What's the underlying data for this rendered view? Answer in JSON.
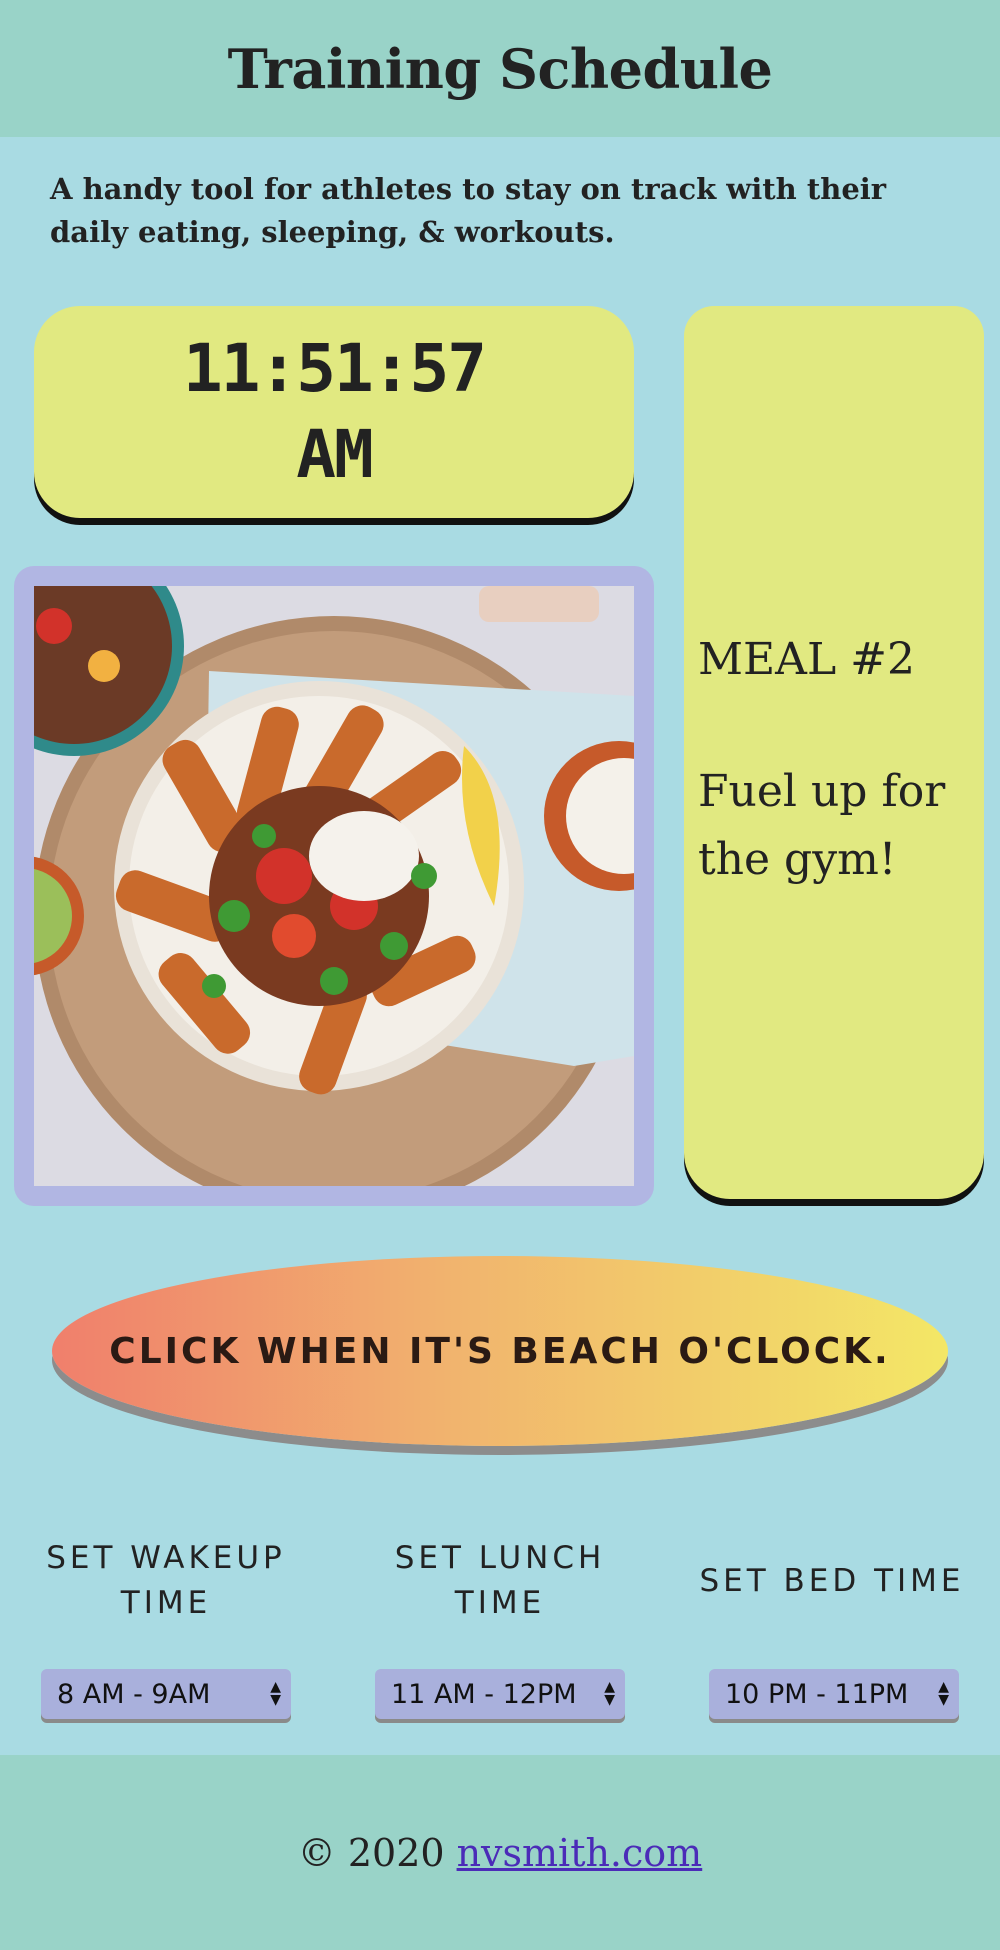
{
  "header": {
    "title": "Training Schedule"
  },
  "tagline": "A handy tool for athletes to stay on track with their daily eating, sleeping, & workouts.",
  "clock": {
    "time": "11:51:57",
    "period": "AM"
  },
  "meal": {
    "title": "MEAL #2",
    "message": "Fuel up for the gym!"
  },
  "beach_button": {
    "label": "CLICK WHEN IT'S BEACH O'CLOCK."
  },
  "times": [
    {
      "label": "SET WAKEUP TIME",
      "selected": "8 AM - 9AM"
    },
    {
      "label": "SET LUNCH TIME",
      "selected": "11 AM - 12PM"
    },
    {
      "label": "SET BED TIME",
      "selected": "10 PM - 11PM"
    }
  ],
  "footer": {
    "copyright": "© 2020",
    "link_text": "nvsmith.com"
  },
  "colors": {
    "background": "#a9dbe3",
    "header": "#99d3c8",
    "panel": "#e1e981",
    "photo_frame": "#b1b6e3",
    "select": "#a9b0dc",
    "link": "#4b2bb8"
  },
  "image": {
    "subject": "bowl of sweet potato fries with beans, salsa and sour cream"
  }
}
